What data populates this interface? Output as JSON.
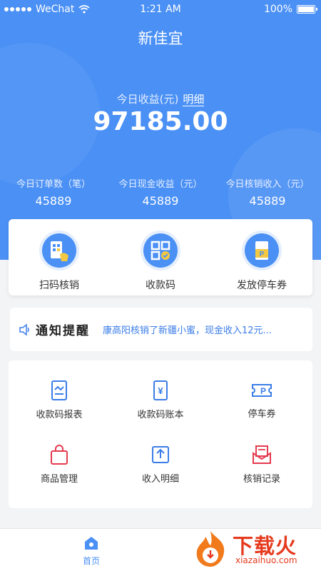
{
  "status_bar": {
    "carrier": "WeChat",
    "time": "1:21 AM",
    "battery": "100%"
  },
  "header": {
    "title": "新佳宜"
  },
  "earnings": {
    "label": "今日收益(元)",
    "detail_link": "明细",
    "value": "97185.00"
  },
  "stats": [
    {
      "label": "今日订单数（笔）",
      "value": "45889"
    },
    {
      "label": "今日现金收益（元）",
      "value": "45889"
    },
    {
      "label": "今日核销收入（元）",
      "value": "45889"
    }
  ],
  "quick_actions": [
    {
      "label": "扫码核销",
      "icon": "scan-verify-icon"
    },
    {
      "label": "收款码",
      "icon": "qr-code-icon"
    },
    {
      "label": "发放停车券",
      "icon": "parking-ticket-icon"
    }
  ],
  "notice": {
    "title": "通知提醒",
    "message": "康高阳核销了新疆小蜜，现金收入12元..."
  },
  "grid_menu": [
    {
      "label": "收款码报表",
      "icon": "report-icon"
    },
    {
      "label": "收款码账本",
      "icon": "ledger-icon"
    },
    {
      "label": "停车券",
      "icon": "parking-coupon-icon"
    },
    {
      "label": "商品管理",
      "icon": "shopping-bag-icon"
    },
    {
      "label": "收入明细",
      "icon": "income-detail-icon"
    },
    {
      "label": "核销记录",
      "icon": "verify-record-icon"
    }
  ],
  "tabbar": {
    "home_label": "首页"
  },
  "watermark": {
    "main": "下载火",
    "sub": "xiazaihuo.com"
  },
  "colors": {
    "primary": "#4a90f5",
    "accent_red": "#e53a1e",
    "link_blue": "#3b7de8"
  }
}
